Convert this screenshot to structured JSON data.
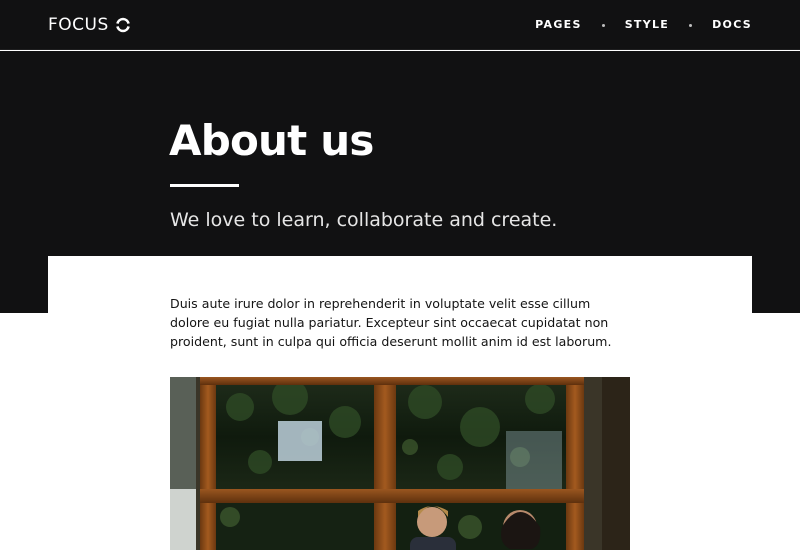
{
  "brand": {
    "name": "FOCUS",
    "icon": "circle-logo-icon"
  },
  "nav": {
    "items": [
      {
        "label": "PAGES"
      },
      {
        "label": "STYLE"
      },
      {
        "label": "DOCS"
      }
    ]
  },
  "hero": {
    "title": "About us",
    "subtitle": "We love to learn, collaborate and create."
  },
  "content": {
    "intro": "Duis aute irure dolor in reprehenderit in voluptate velit esse cillum dolore eu fugiat nulla pariatur. Excepteur sint occaecat cupidatat non proident, sunt in culpa qui officia deserunt mollit anim id est laborum."
  },
  "colors": {
    "header_bg": "#111112",
    "text_light": "#ffffff",
    "body_text": "#141414",
    "window_frame": "#8a4a17"
  }
}
